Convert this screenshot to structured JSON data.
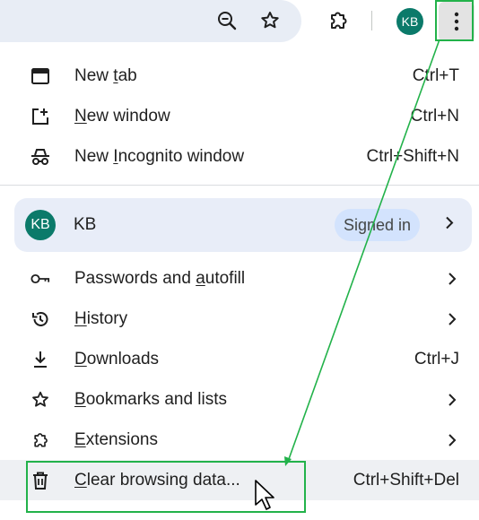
{
  "toolbar": {
    "icons": [
      "zoom-icon",
      "bookmark-star-icon",
      "extensions-icon",
      "profile-avatar",
      "more-menu-icon"
    ],
    "avatar_initials": "KB"
  },
  "menu": {
    "top_items": [
      {
        "label": "New tab",
        "shortcut": "Ctrl+T",
        "icon": "new-tab-icon"
      },
      {
        "label": "New window",
        "shortcut": "Ctrl+N",
        "icon": "new-window-icon"
      },
      {
        "label": "New Incognito window",
        "shortcut": "Ctrl+Shift+N",
        "icon": "incognito-icon"
      }
    ],
    "profile": {
      "initials": "KB",
      "name": "KB",
      "status": "Signed in"
    },
    "items": [
      {
        "label": "Passwords and autofill",
        "icon": "key-icon",
        "submenu": true
      },
      {
        "label": "History",
        "icon": "history-icon",
        "submenu": true
      },
      {
        "label": "Downloads",
        "shortcut": "Ctrl+J",
        "icon": "download-icon"
      },
      {
        "label": "Bookmarks and lists",
        "icon": "star-icon",
        "submenu": true
      },
      {
        "label": "Extensions",
        "icon": "extensions-icon",
        "submenu": true
      },
      {
        "label": "Clear browsing data...",
        "shortcut": "Ctrl+Shift+Del",
        "icon": "trash-icon",
        "highlighted": true
      }
    ]
  },
  "colors": {
    "annotation": "#22b24a",
    "avatar": "#0b7a6a",
    "profile_bg": "#e8edf8",
    "badge_bg": "#d3e3fd"
  }
}
